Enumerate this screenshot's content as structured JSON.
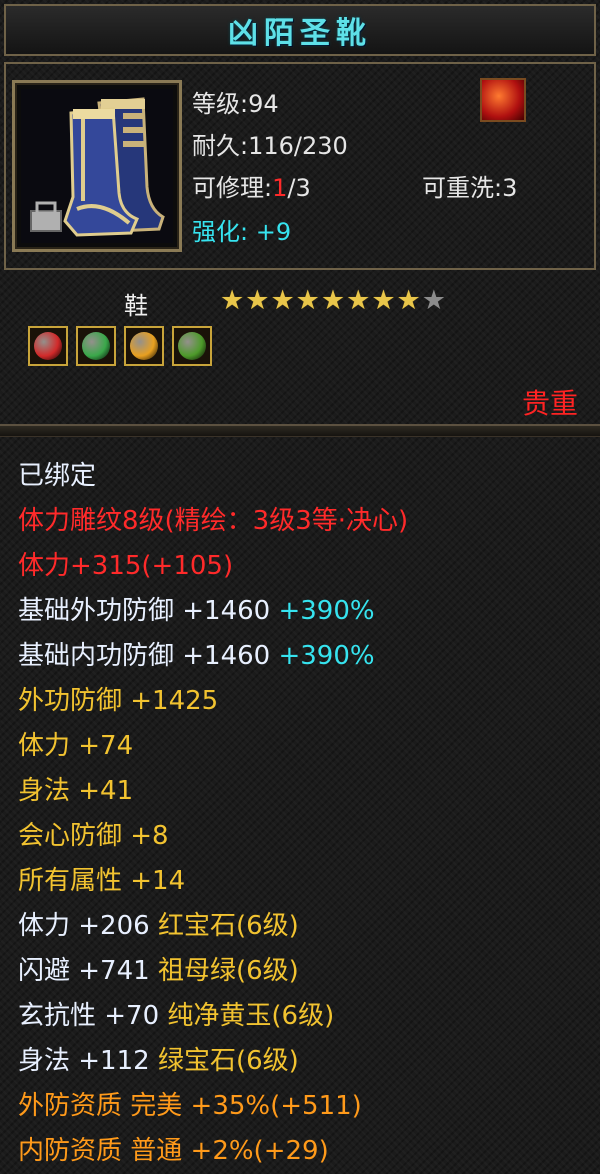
{
  "item": {
    "name": "凶陌圣靴",
    "level_label": "等级",
    "level_value": "94",
    "durability_label": "耐久",
    "durability_value": "116/230",
    "repair_label": "可修理",
    "repair_used": "1",
    "repair_max": "/3",
    "rewash_label": "可重洗",
    "rewash_value": "3",
    "enhance_label": "强化:",
    "enhance_value": "+9",
    "type": "鞋",
    "stars_filled": 8,
    "stars_total": 9,
    "rarity": "贵重",
    "icon": "blue-boots-icon",
    "badge_icon": "phoenix-emblem-icon"
  },
  "gems": [
    {
      "name": "red-gem-icon",
      "color": "#d22a2a"
    },
    {
      "name": "green-gem-icon",
      "color": "#3aa84a"
    },
    {
      "name": "yellow-gem-icon",
      "color": "#e8a020"
    },
    {
      "name": "green-jade-icon",
      "color": "#4d9a2a"
    }
  ],
  "attributes": [
    {
      "text": "已绑定",
      "color": "white"
    },
    {
      "text": "体力雕纹8级(精绘：3级3等·决心)",
      "color": "red"
    },
    {
      "text": "体力+315(+105)",
      "color": "red"
    },
    {
      "text": "基础外功防御 +1460",
      "extra": " +390%",
      "color": "white"
    },
    {
      "text": "基础内功防御 +1460",
      "extra": " +390%",
      "color": "white"
    },
    {
      "text": "外功防御 +1425",
      "color": "yellow"
    },
    {
      "text": "体力 +74",
      "color": "yellow"
    },
    {
      "text": "身法 +41",
      "color": "yellow"
    },
    {
      "text": "会心防御 +8",
      "color": "yellow"
    },
    {
      "text": "所有属性 +14",
      "color": "yellow"
    },
    {
      "text": "体力 +206",
      "extra": " 红宝石(6级)",
      "color": "white",
      "extra_color": "yellow"
    },
    {
      "text": "闪避 +741",
      "extra": " 祖母绿(6级)",
      "color": "white",
      "extra_color": "yellow"
    },
    {
      "text": "玄抗性 +70",
      "extra": " 纯净黄玉(6级)",
      "color": "white",
      "extra_color": "yellow"
    },
    {
      "text": "身法 +112",
      "extra": " 绿宝石(6级)",
      "color": "white",
      "extra_color": "yellow"
    },
    {
      "text": "外防资质  完美 +35%(+511)",
      "color": "orange"
    },
    {
      "text": "内防资质  普通 +2%(+29)",
      "color": "orange"
    }
  ]
}
